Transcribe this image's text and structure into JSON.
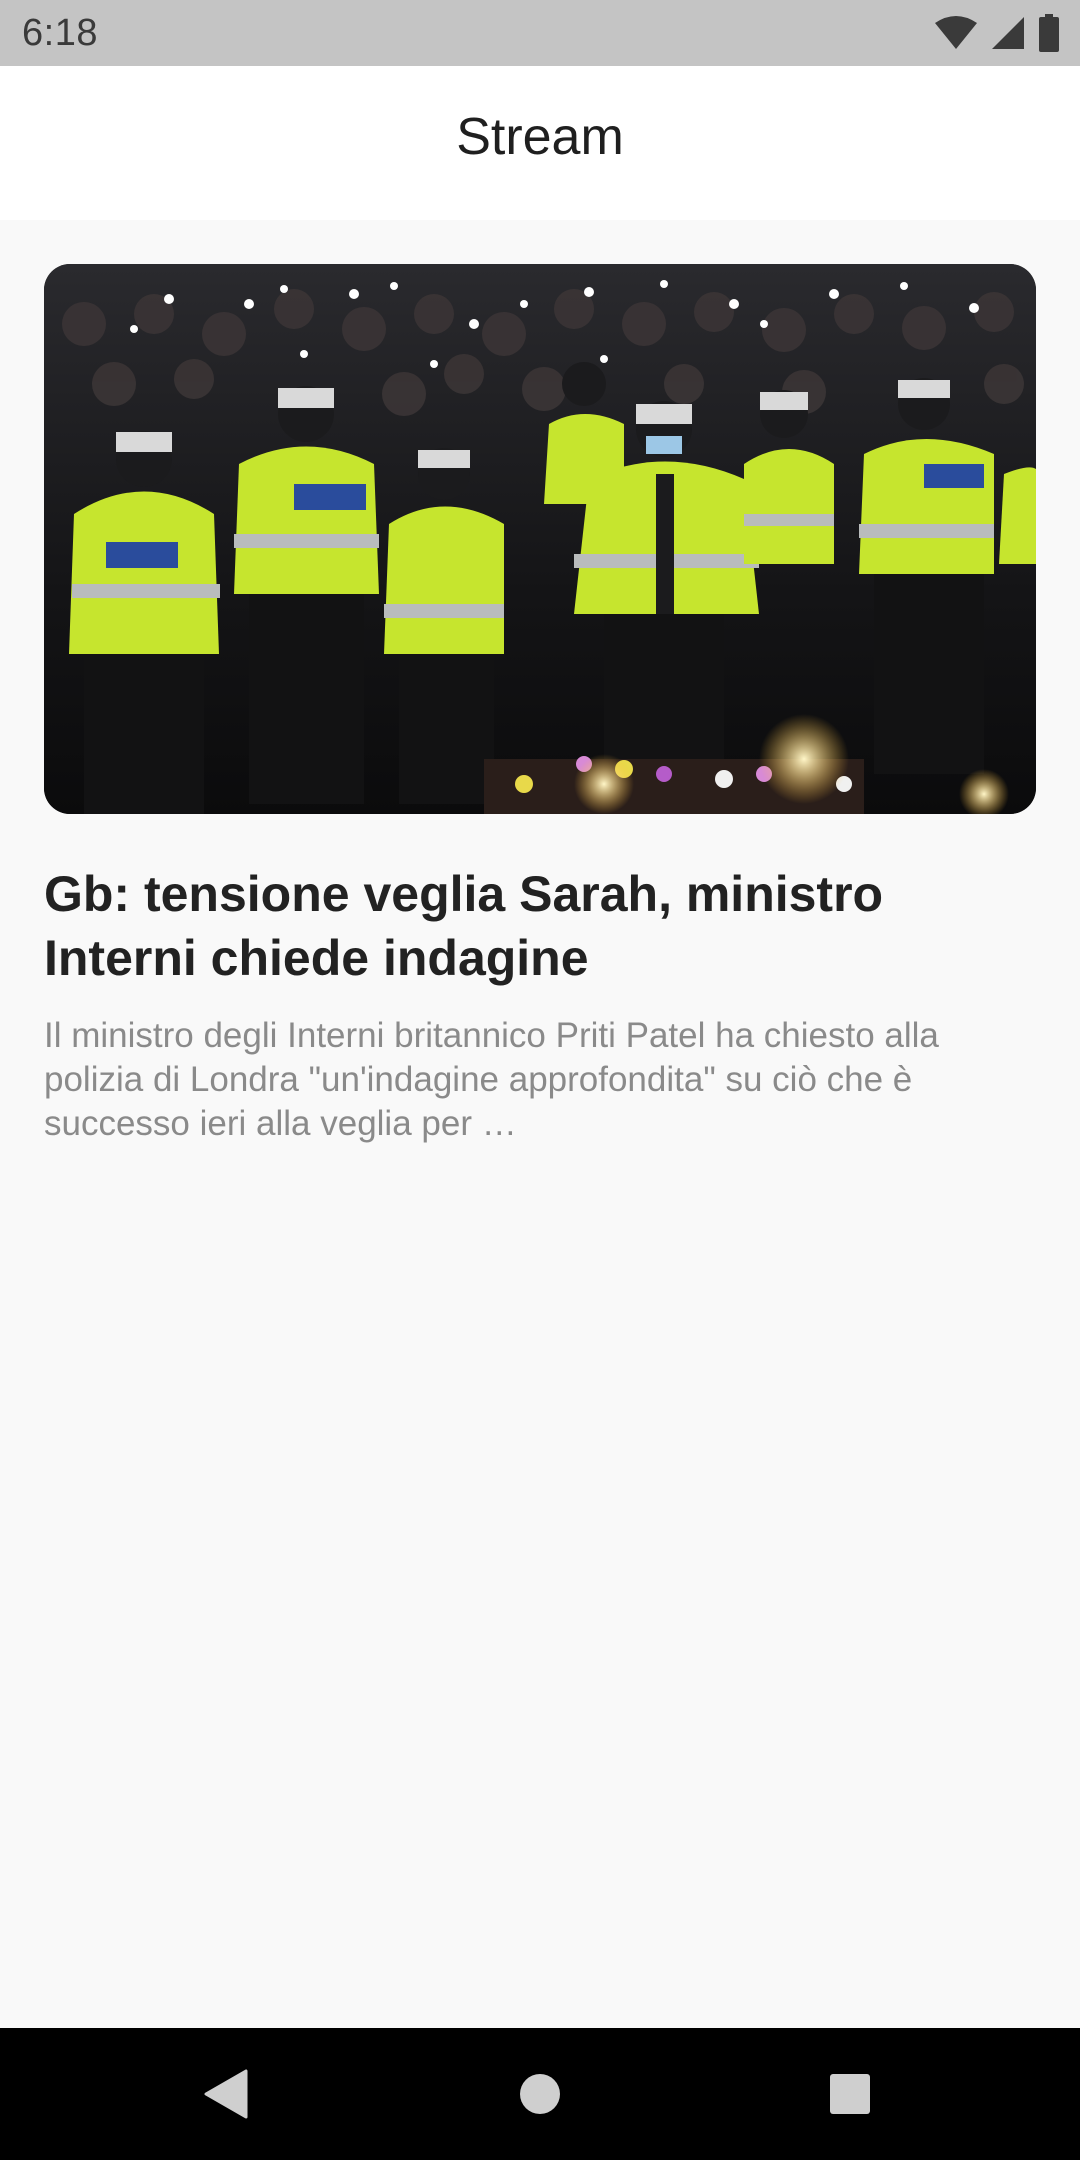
{
  "status_bar": {
    "time": "6:18",
    "icons": [
      "wifi-icon",
      "signal-icon",
      "battery-icon"
    ]
  },
  "app_bar": {
    "title": "Stream"
  },
  "feed": {
    "items": [
      {
        "image": "photo of police officers in high-visibility jackets at a candlelit vigil",
        "title": "Gb: tensione veglia Sarah, ministro Interni chiede indagine",
        "summary": "Il ministro degli Interni britannico Priti Patel ha chiesto alla polizia di Londra \"un'indagine approfondita\" su ciò che è successo ieri alla veglia per …"
      }
    ]
  },
  "nav_bar": {
    "buttons": [
      "back-icon",
      "home-icon",
      "recents-icon"
    ]
  },
  "colors": {
    "status_bar": "#c4c4c4",
    "app_bar": "#ffffff",
    "background": "#f9f9f9",
    "title_text": "#222222",
    "summary_text": "#8a8a8a",
    "nav_bar": "#000000",
    "hi_vis": "#c6e52e"
  }
}
